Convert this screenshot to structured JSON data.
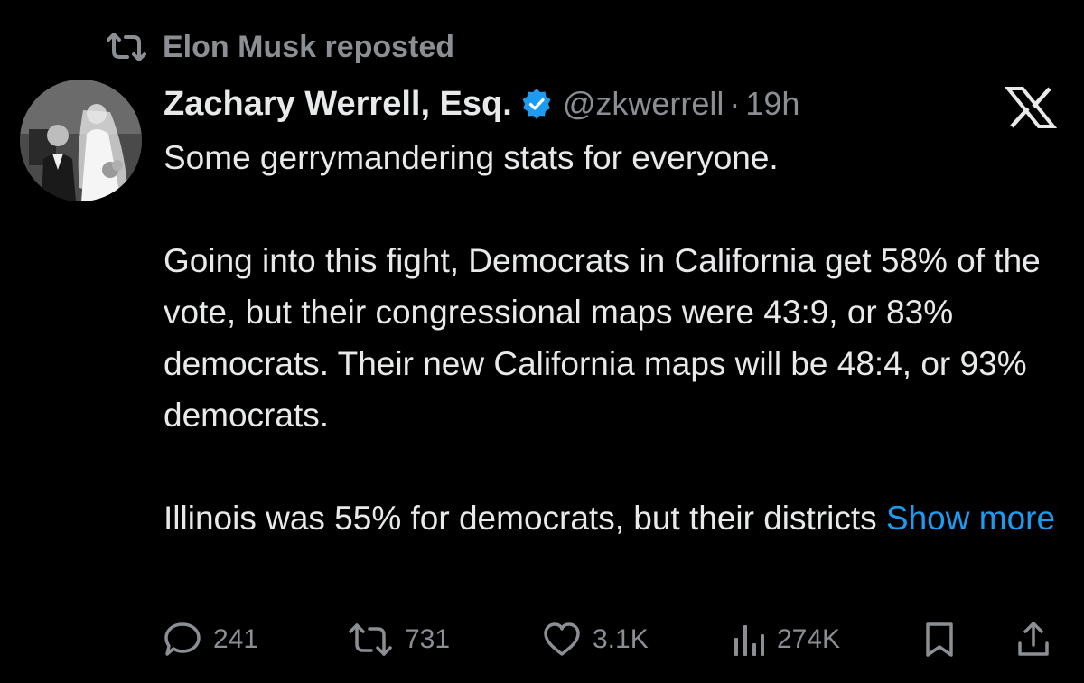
{
  "repost": {
    "icon": "repost-icon",
    "label": "Elon Musk reposted"
  },
  "author": {
    "avatar_icon": "avatar",
    "display_name": "Zachary Werrell, Esq.",
    "verified_icon": "verified-badge-icon",
    "handle": "@zkwerrell",
    "separator": "·",
    "time": "19h"
  },
  "brand": {
    "logo_icon": "x-logo-icon"
  },
  "post": {
    "para1": "Some gerrymandering stats for everyone.",
    "para2": "Going into this fight, Democrats in California get 58% of the vote, but their congressional maps were 43:9, or 83% democrats. Their new California maps will be 48:4, or 93% democrats.",
    "para3": "Illinois was 55% for democrats, but their districts",
    "show_more": "Show more"
  },
  "actions": {
    "reply": {
      "icon": "reply-icon",
      "count": "241"
    },
    "repost": {
      "icon": "repost-icon",
      "count": "731"
    },
    "like": {
      "icon": "heart-icon",
      "count": "3.1K"
    },
    "views": {
      "icon": "views-icon",
      "count": "274K"
    },
    "bookmark": {
      "icon": "bookmark-icon"
    },
    "share": {
      "icon": "share-icon"
    }
  },
  "colors": {
    "background": "#000000",
    "text": "#e7e9ea",
    "muted": "#8b8f94",
    "link": "#1d9bf0",
    "verified": "#1d9bf0"
  }
}
